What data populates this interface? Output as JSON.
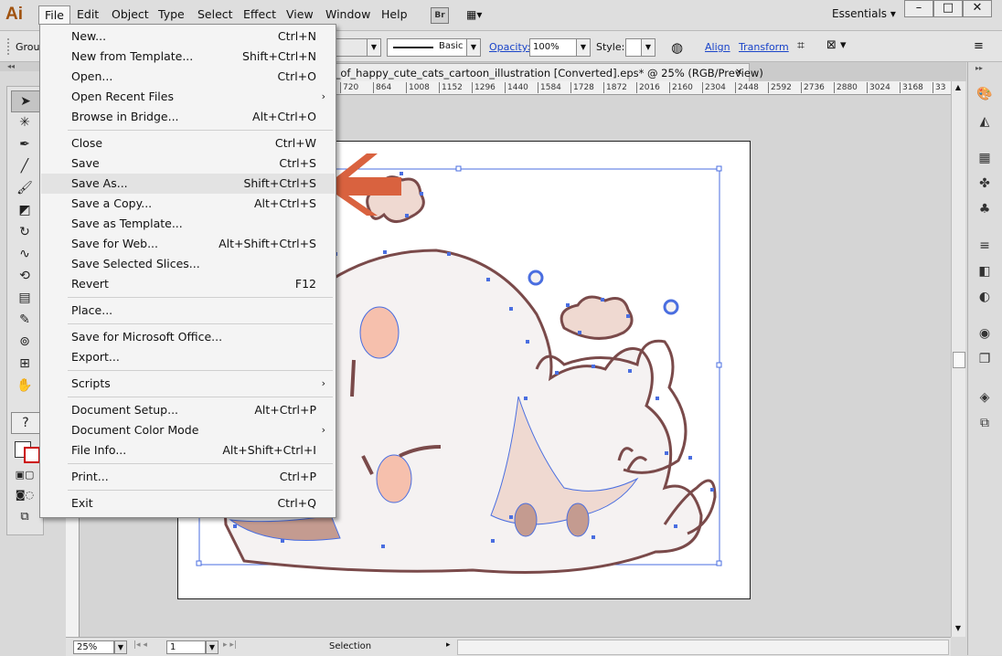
{
  "app": {
    "logo": "Ai"
  },
  "menubar": {
    "items": [
      "File",
      "Edit",
      "Object",
      "Type",
      "Select",
      "Effect",
      "View",
      "Window",
      "Help"
    ],
    "bridge": "Br",
    "workspace": "Essentials",
    "window_buttons": [
      "–",
      "□",
      "✕"
    ]
  },
  "controlbar": {
    "selection_label": "Group",
    "stroke_style": "Basic",
    "opacity_label": "Opacity:",
    "opacity_value": "100%",
    "style_label": "Style:",
    "align_label": "Align",
    "transform_label": "Transform"
  },
  "document": {
    "tab_title": "et_of_happy_cute_cats_cartoon_illustration [Converted].eps* @ 25% (RGB/Preview)",
    "ruler_ticks": [
      "720",
      "864",
      "1008",
      "1152",
      "1296",
      "1440",
      "1584",
      "1728",
      "1872",
      "2016",
      "2160",
      "2304",
      "2448",
      "2592",
      "2736",
      "2880",
      "3024",
      "3168",
      "33"
    ]
  },
  "statusbar": {
    "zoom": "25%",
    "artboard_num": "1",
    "tool": "Selection"
  },
  "file_menu": {
    "items": [
      {
        "label": "New...",
        "shortcut": "Ctrl+N"
      },
      {
        "label": "New from Template...",
        "shortcut": "Shift+Ctrl+N"
      },
      {
        "label": "Open...",
        "shortcut": "Ctrl+O"
      },
      {
        "label": "Open Recent Files",
        "shortcut": "",
        "submenu": true
      },
      {
        "label": "Browse in Bridge...",
        "shortcut": "Alt+Ctrl+O"
      },
      {
        "label": "Close",
        "shortcut": "Ctrl+W"
      },
      {
        "label": "Save",
        "shortcut": "Ctrl+S"
      },
      {
        "label": "Save As...",
        "shortcut": "Shift+Ctrl+S",
        "highlighted": true
      },
      {
        "label": "Save a Copy...",
        "shortcut": "Alt+Ctrl+S"
      },
      {
        "label": "Save as Template...",
        "shortcut": ""
      },
      {
        "label": "Save for Web...",
        "shortcut": "Alt+Shift+Ctrl+S"
      },
      {
        "label": "Save Selected Slices...",
        "shortcut": ""
      },
      {
        "label": "Revert",
        "shortcut": "F12"
      },
      {
        "label": "Place...",
        "shortcut": ""
      },
      {
        "label": "Save for Microsoft Office...",
        "shortcut": ""
      },
      {
        "label": "Export...",
        "shortcut": ""
      },
      {
        "label": "Scripts",
        "shortcut": "",
        "submenu": true
      },
      {
        "label": "Document Setup...",
        "shortcut": "Alt+Ctrl+P"
      },
      {
        "label": "Document Color Mode",
        "shortcut": "",
        "submenu": true
      },
      {
        "label": "File Info...",
        "shortcut": "Alt+Shift+Ctrl+I"
      },
      {
        "label": "Print...",
        "shortcut": "Ctrl+P"
      },
      {
        "label": "Exit",
        "shortcut": "Ctrl+Q"
      }
    ]
  },
  "colors": {
    "arrow": "#d9623f",
    "selection": "#4a6ee0",
    "outline": "#7a4a4a",
    "fill_pink": "#f6c0ad",
    "fill_body": "#f5f2f2",
    "fill_shade": "#efd9d1"
  }
}
